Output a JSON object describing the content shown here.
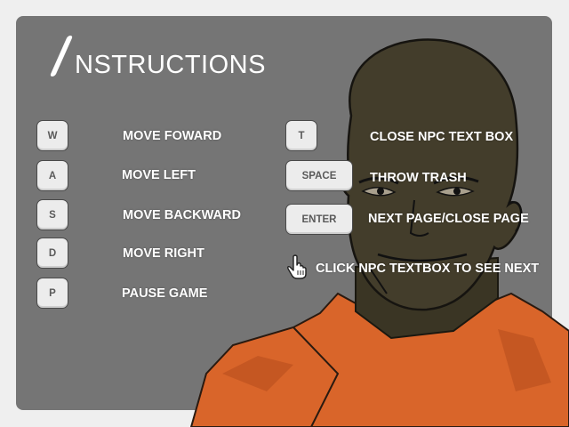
{
  "title": {
    "letter": "I",
    "rest": "NSTRUCTIONS"
  },
  "controls_left": [
    {
      "key": "W",
      "label": "MOVE FOWARD"
    },
    {
      "key": "A",
      "label": "MOVE LEFT"
    },
    {
      "key": "S",
      "label": "MOVE BACKWARD"
    },
    {
      "key": "D",
      "label": "MOVE RIGHT"
    },
    {
      "key": "P",
      "label": "PAUSE GAME"
    }
  ],
  "controls_right": [
    {
      "key": "T",
      "label": "CLOSE NPC TEXT BOX"
    },
    {
      "key": "SPACE",
      "label": "THROW TRASH"
    },
    {
      "key": "ENTER",
      "label": "NEXT PAGE/CLOSE PAGE"
    }
  ],
  "mouse_hint": {
    "icon": "hand-pointer-icon",
    "label": "CLICK NPC TEXTBOX TO SEE NEXT"
  },
  "colors": {
    "panel": "#757575",
    "page": "#efefef",
    "jumpsuit": "#d9652a",
    "key_face": "#ececec"
  }
}
